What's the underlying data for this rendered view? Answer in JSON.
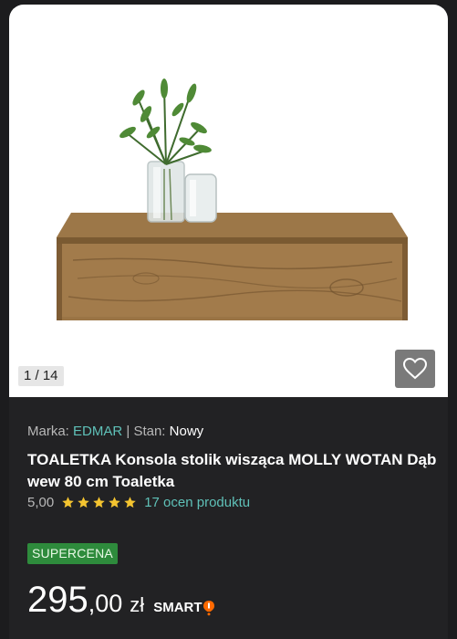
{
  "gallery": {
    "counter": "1 / 14",
    "image_alt": "product-photo"
  },
  "product": {
    "brand_label": "Marka:",
    "brand": "EDMAR",
    "separator": "|",
    "condition_label": "Stan:",
    "condition": "Nowy",
    "title": "TOALETKA Konsola stolik wisząca MOLLY WOTAN Dąb wew 80 cm Toaletka",
    "rating_value": "5,00",
    "stars": 5,
    "rating_count": "17 ocen produktu",
    "badge": "SUPERCENA",
    "price_int": "295",
    "price_dec": ",00",
    "currency": "zł",
    "smart_label": "SMART"
  },
  "colors": {
    "background": "#1c1c1e",
    "card": "#222224",
    "accent": "#5fc1b8",
    "badge": "#2e8b3c",
    "star": "#f4c430",
    "smart_icon": "#ff6a00"
  },
  "icons": {
    "favorite": "heart-outline-icon",
    "star": "star-icon",
    "smart": "smart-bang-icon"
  }
}
